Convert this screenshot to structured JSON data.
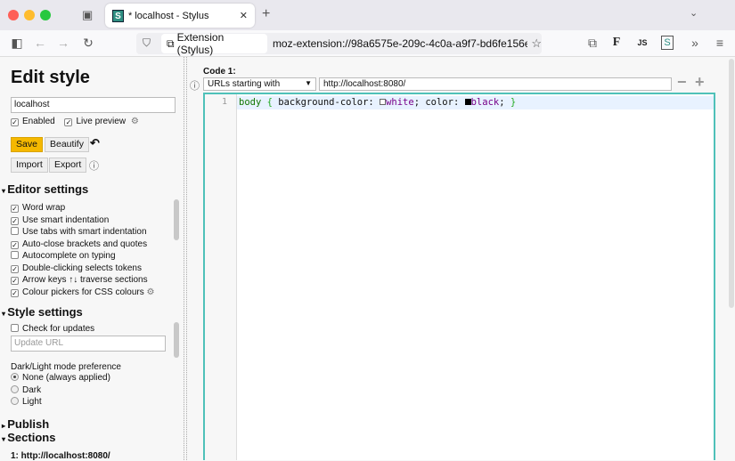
{
  "browser": {
    "tab_title": "* localhost - Stylus",
    "favicon": "S",
    "identity": "Extension (Stylus)",
    "url": "moz-extension://98a6575e-209c-4c0a-a9f7-bd6fe156eb37/",
    "toolbar_js": "JS",
    "toolbar_f": "F",
    "toolbar_s": "S"
  },
  "sidebar": {
    "title": "Edit style",
    "name_value": "localhost",
    "enabled": "Enabled",
    "live_preview": "Live preview",
    "save": "Save",
    "beautify": "Beautify",
    "import": "Import",
    "export": "Export",
    "editor_settings": "Editor settings",
    "options": [
      {
        "label": "Word wrap",
        "checked": true
      },
      {
        "label": "Use smart indentation",
        "checked": true
      },
      {
        "label": "Use tabs with smart indentation",
        "checked": false
      },
      {
        "label": "Auto-close brackets and quotes",
        "checked": true
      },
      {
        "label": "Autocomplete on typing",
        "checked": false
      },
      {
        "label": "Double-clicking selects tokens",
        "checked": true
      },
      {
        "label": "Arrow keys ↑↓ traverse sections",
        "checked": true
      },
      {
        "label": "Colour pickers for CSS colours",
        "checked": true
      }
    ],
    "style_settings": "Style settings",
    "check_updates": "Check for updates",
    "update_url_placeholder": "Update URL",
    "mode_label": "Dark/Light mode preference",
    "modes": [
      "None (always applied)",
      "Dark",
      "Light"
    ],
    "publish": "Publish",
    "sections": "Sections",
    "section_1": "1: http://localhost:8080/"
  },
  "main": {
    "code_label": "Code 1:",
    "applies_type": "URLs starting with",
    "applies_value": "http://localhost:8080/",
    "line_number": "1",
    "code": {
      "selector": "body",
      "open": "{",
      "prop1": "background-color:",
      "val1": "white",
      "semi1": ";",
      "prop2": "color:",
      "val2": "black",
      "semi2": ";",
      "close": "}"
    }
  },
  "colors": {
    "accent": "#4fc1b9",
    "save": "#f5b800"
  }
}
